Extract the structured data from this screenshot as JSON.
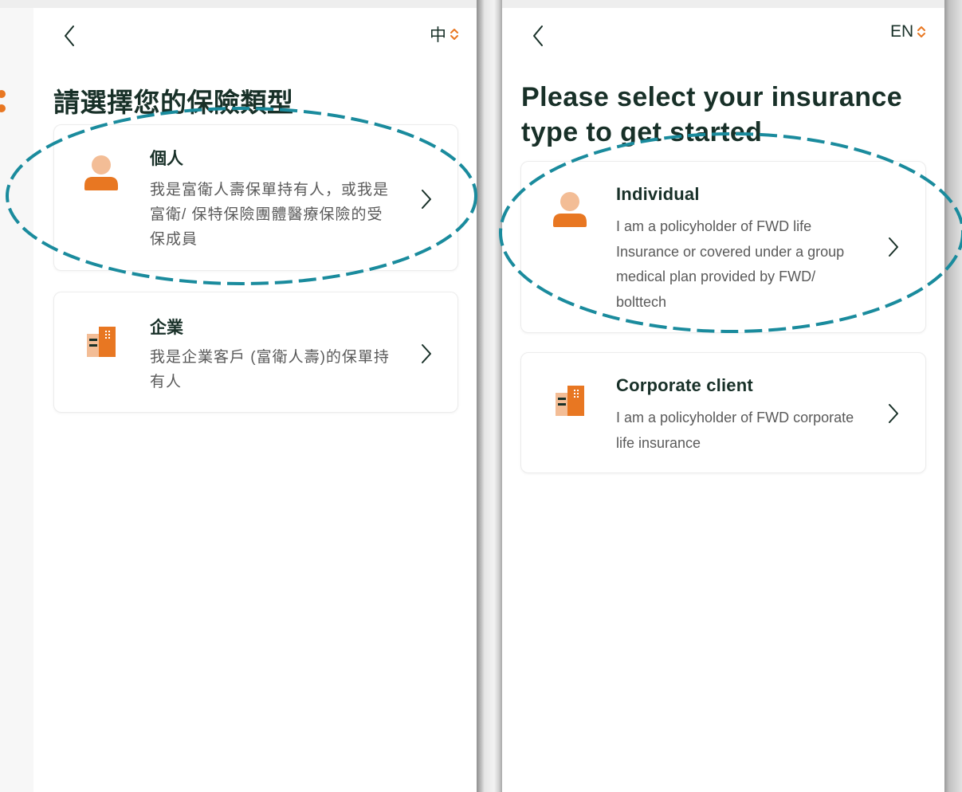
{
  "colors": {
    "accent": "#e87722",
    "accent_light": "#f3bd96",
    "highlight_dash": "#1a8b9d",
    "text_dark": "#183028",
    "text_secondary": "#5a5a5a"
  },
  "chinese_screen": {
    "back_icon": "chevron-left-icon",
    "language_label": "中",
    "language_toggle_icon": "up-down-chevron-icon",
    "title": "請選擇您的保險類型",
    "cards": [
      {
        "icon": "person-icon",
        "title": "個人",
        "description": "我是富衛人壽保單持有人，或我是富衛/ 保特保險團體醫療保險的受保成員"
      },
      {
        "icon": "building-icon",
        "title": "企業",
        "description": "我是企業客戶 (富衛人壽)的保單持有人"
      }
    ]
  },
  "english_screen": {
    "back_icon": "chevron-left-icon",
    "language_label": "EN",
    "language_toggle_icon": "up-down-chevron-icon",
    "title": "Please select your insurance type to get started",
    "cards": [
      {
        "icon": "person-icon",
        "title": "Individual",
        "description": "I am a policyholder of FWD life Insurance or covered under a group medical plan provided by FWD/ bolttech"
      },
      {
        "icon": "building-icon",
        "title": "Corporate client",
        "description": "I am a policyholder of FWD corporate life insurance"
      }
    ]
  }
}
